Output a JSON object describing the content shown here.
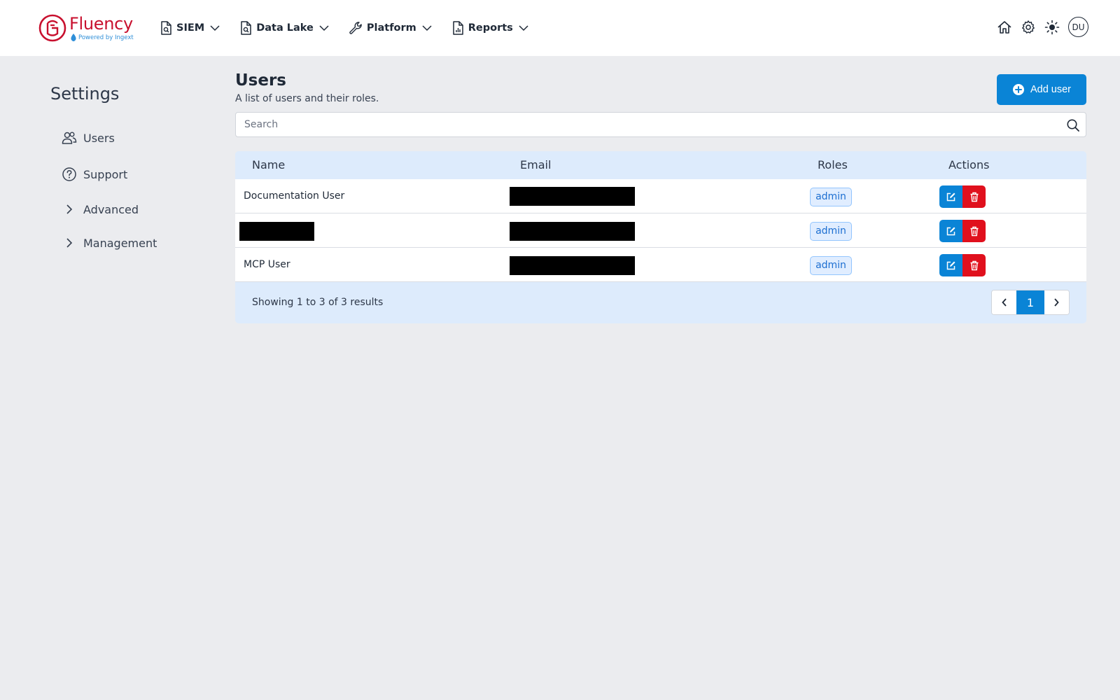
{
  "brand": {
    "name": "Fluency",
    "powered_by": "Powered by Ingext",
    "primary_color": "#c8102e",
    "accent_color": "#0a84d6"
  },
  "nav": {
    "items": [
      {
        "label": "SIEM",
        "icon": "document-search-icon"
      },
      {
        "label": "Data Lake",
        "icon": "document-search-icon"
      },
      {
        "label": "Platform",
        "icon": "wrench-icon"
      },
      {
        "label": "Reports",
        "icon": "report-chart-icon"
      }
    ],
    "user_initials": "DU"
  },
  "sidebar": {
    "title": "Settings",
    "items": [
      {
        "label": "Users",
        "icon": "users-icon"
      },
      {
        "label": "Support",
        "icon": "question-circle-icon"
      },
      {
        "label": "Advanced",
        "icon": "chevron-right-icon"
      },
      {
        "label": "Management",
        "icon": "chevron-right-icon"
      }
    ]
  },
  "main": {
    "title": "Users",
    "subtitle": "A list of users and their roles.",
    "add_button": "Add user",
    "search": {
      "placeholder": "Search",
      "value": ""
    },
    "table": {
      "columns": [
        "Name",
        "Email",
        "Roles",
        "Actions"
      ],
      "rows": [
        {
          "name": "Documentation User",
          "role": "admin"
        },
        {
          "name": "",
          "role": "admin"
        },
        {
          "name": "MCP User",
          "role": "admin"
        }
      ]
    },
    "pagination": {
      "summary": "Showing 1 to 3 of 3 results",
      "current_page": "1"
    }
  }
}
